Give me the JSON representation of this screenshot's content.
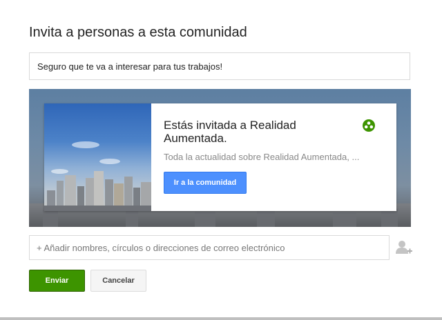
{
  "dialog": {
    "title": "Invita a personas a esta comunidad",
    "message": "Seguro que te va a interesar para tus trabajos!"
  },
  "card": {
    "title": "Estás invitada a Realidad Aumentada.",
    "subtitle": "Toda la actualidad sobre Realidad Aumentada, ...",
    "button_label": "Ir a la comunidad",
    "icon": "community-icon"
  },
  "people": {
    "placeholder": "+ Añadir nombres, círculos o direcciones de correo electrónico",
    "icon": "add-person-icon"
  },
  "actions": {
    "send_label": "Enviar",
    "cancel_label": "Cancelar"
  },
  "colors": {
    "primary_button": "#4d90fe",
    "send_button": "#3d9400",
    "community_icon": "#3d9400"
  }
}
